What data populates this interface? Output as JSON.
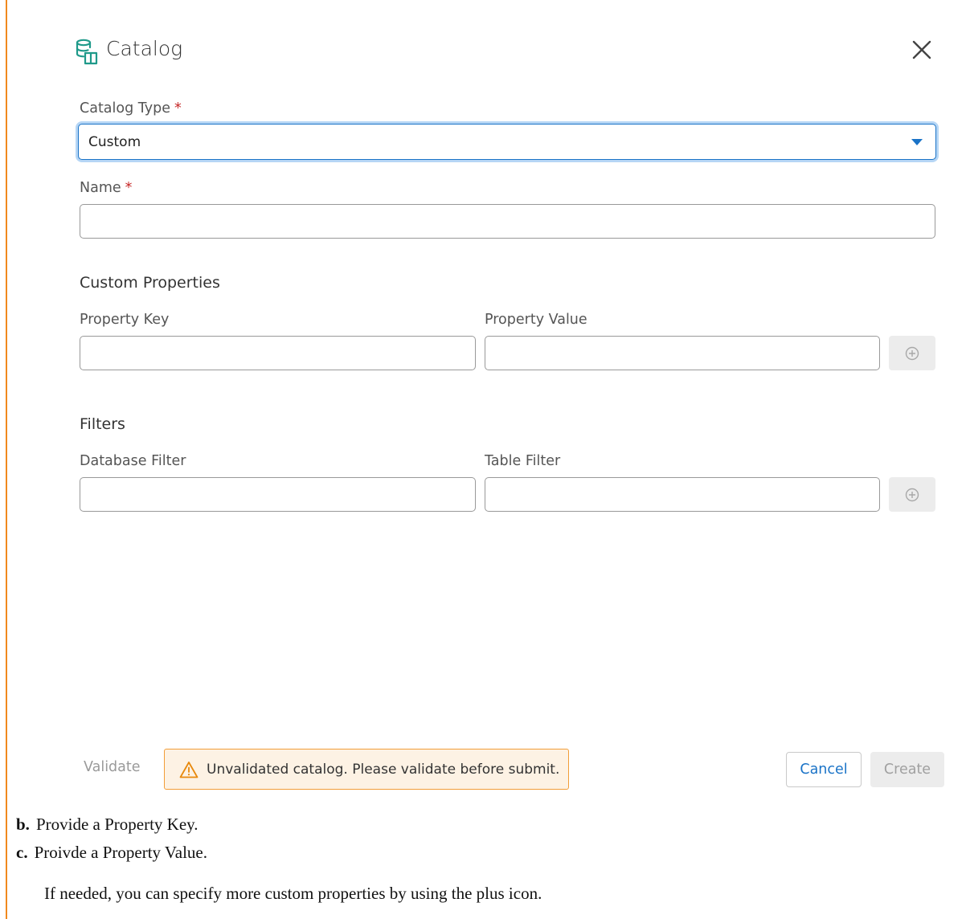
{
  "dialog": {
    "title": "Catalog",
    "icon": "catalog-icon",
    "close_icon": "close-icon"
  },
  "form": {
    "catalog_type": {
      "label": "Catalog Type",
      "required_mark": "*",
      "value": "Custom"
    },
    "name": {
      "label": "Name",
      "required_mark": "*",
      "value": ""
    },
    "custom_properties": {
      "title": "Custom Properties",
      "key_label": "Property Key",
      "value_label": "Property Value",
      "add_icon": "plus-circle-icon"
    },
    "filters": {
      "title": "Filters",
      "database_label": "Database Filter",
      "table_label": "Table Filter",
      "add_icon": "plus-circle-icon"
    }
  },
  "footer": {
    "validate_label": "Validate",
    "warning_text": "Unvalidated catalog. Please validate before submit.",
    "warning_icon": "warning-triangle-icon",
    "cancel_label": "Cancel",
    "create_label": "Create"
  },
  "doc_steps": [
    {
      "marker": "b.",
      "text": "Provide a Property Key."
    },
    {
      "marker": "c.",
      "text": "Proivde a Property Value."
    }
  ],
  "doc_note": "If needed, you can specify more custom properties by using the plus icon.",
  "colors": {
    "accent": "#1a73c7",
    "required": "#c62828",
    "warning_border": "#f29d38",
    "warning_bg": "#fdf2e4",
    "left_rule": "#f0891e",
    "icon_teal": "#1f9a8a"
  }
}
